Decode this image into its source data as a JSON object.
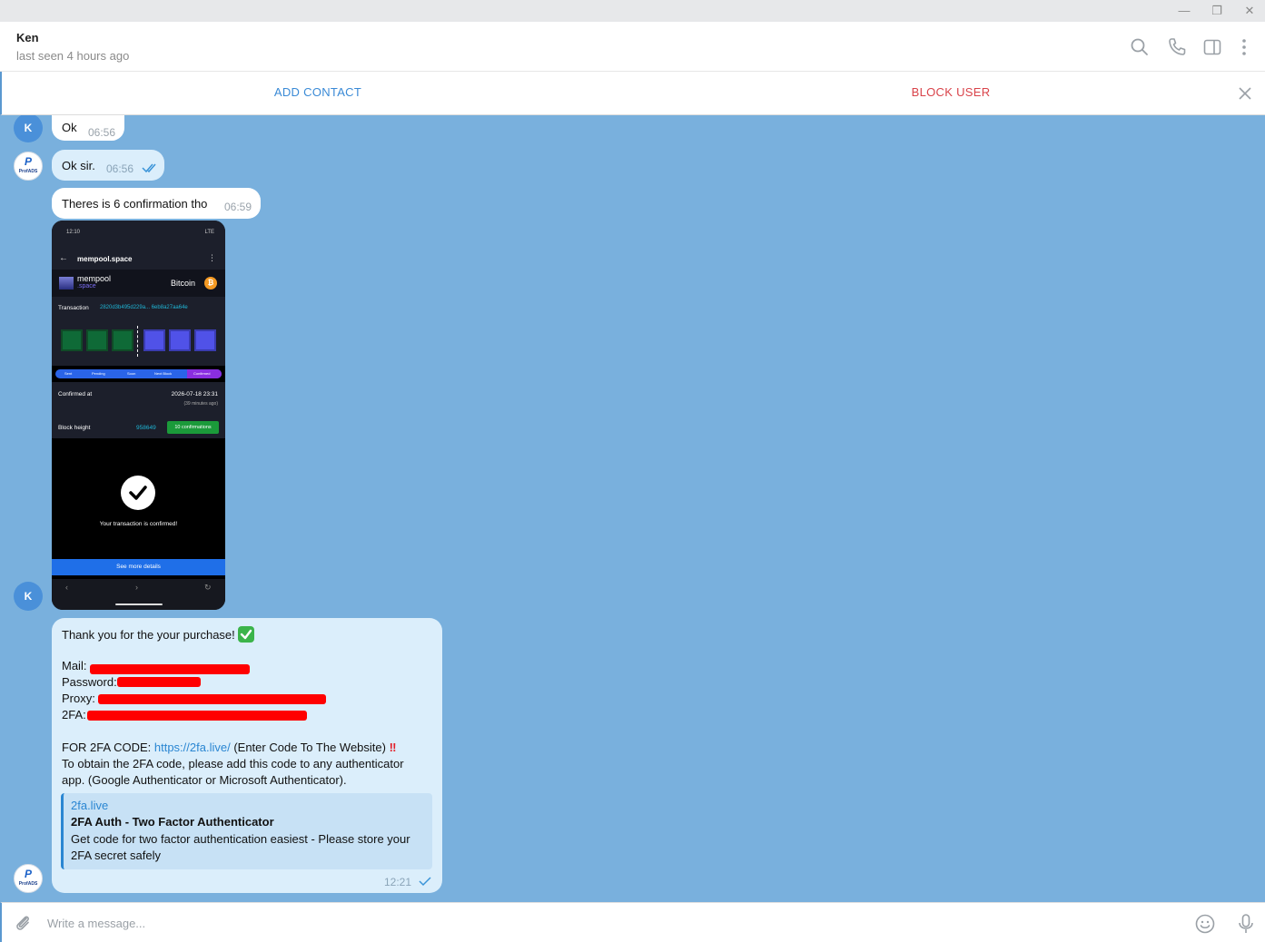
{
  "window": {
    "minimize": "—",
    "maximize": "❐",
    "close": "✕"
  },
  "header": {
    "name": "Ken",
    "status": "last seen 4 hours ago",
    "icons": [
      "search-icon",
      "phone-icon",
      "sidebar-toggle-icon",
      "more-vertical-icon"
    ]
  },
  "actionbar": {
    "add_contact": "ADD CONTACT",
    "block_user": "BLOCK USER"
  },
  "avatars": {
    "ken_initial": "K",
    "profads_mark": "P",
    "profads_text": "ProfADS"
  },
  "messages": [
    {
      "text": "Ok",
      "time": "06:56"
    },
    {
      "text": "Ok sir.",
      "time": "06:56",
      "status": "read"
    },
    {
      "text": "Theres is 6 confirmation tho",
      "time": "06:59"
    }
  ],
  "screenshot": {
    "status_time": "12:10",
    "status_right": "LTE",
    "url": "mempool.space",
    "logo_line1": "mempool",
    "logo_line2": ".space",
    "network": "Bitcoin",
    "tx_label": "Transaction",
    "tx_hash": "2820d3b495d229a... 6eb8a27aa64e",
    "progress_steps": [
      "Sent",
      "Pending",
      "Soon",
      "Next Block",
      "Confirmed"
    ],
    "confirmed_label": "Confirmed at",
    "confirmed_value": "2026-07-18 23:31",
    "confirmed_ago": "(39 minutes ago)",
    "block_label": "Block height",
    "block_value": "958649",
    "confirmations": "10 confirmations",
    "success_text": "Your transaction is confirmed!",
    "more_button": "See more details"
  },
  "purchase": {
    "thanks": "Thank you for the your purchase!",
    "mail_label": "Mail:",
    "password_label": "Password:",
    "proxy_label": "Proxy:",
    "twofa_label": "2FA:",
    "twofa_prefix": "FOR 2FA CODE:",
    "twofa_link": "https://2fa.live/",
    "twofa_suffix": "(Enter Code To The Website)",
    "instr_1": "To obtain the 2FA code, please add this code to any authenticator",
    "instr_2": "app. (Google Authenticator or Microsoft Authenticator).",
    "preview_site": "2fa.live",
    "preview_title": "2FA Auth - Two Factor Authenticator",
    "preview_desc": "Get code for two factor authentication easiest - Please store your 2FA secret safely",
    "time": "12:21",
    "status": "sent"
  },
  "composer": {
    "placeholder": "Write a message..."
  }
}
